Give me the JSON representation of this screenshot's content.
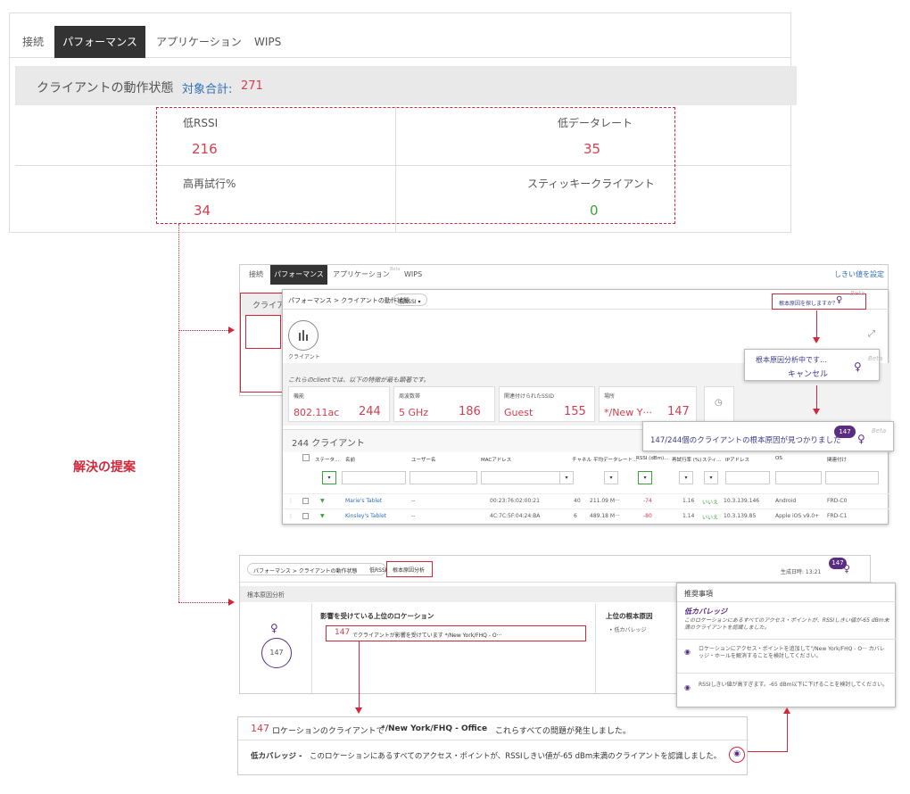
{
  "panel1": {
    "tabs": [
      "接続",
      "パフォーマンス",
      "アプリケーション",
      "WIPS"
    ],
    "title": "クライアントの動作状態",
    "count_label": "対象合計:",
    "count_value": "271",
    "metrics": [
      {
        "label": "低RSSI",
        "value": "216"
      },
      {
        "label": "低データレート",
        "value": "35"
      },
      {
        "label": "高再試行%",
        "value": "34"
      },
      {
        "label": "スティッキークライアント",
        "value": "0"
      }
    ]
  },
  "solution_label": "解決の提案",
  "panel2": {
    "tabs": [
      "接続",
      "パフォーマンス",
      "アプリケーション",
      "WIPS"
    ],
    "tab_beta": "Beta",
    "threshold_link": "しきい値を設定",
    "back_header": "クライア",
    "breadcrumb": "パフォーマンス > クライアントの動作状態",
    "breadcrumb_chip": "低RSSI ▾",
    "root_cause_question": "根本原因を探しますか？",
    "client_icon_label": "クライアント",
    "intro_text": "これらのclientでは、以下の特徴が最も顕著です。",
    "cards": [
      {
        "label": "機能",
        "a": "802.11ac",
        "b": "244"
      },
      {
        "label": "周波数帯",
        "a": "5 GHz",
        "b": "186"
      },
      {
        "label": "関連付けられたSSID",
        "a": "Guest",
        "b": "155"
      },
      {
        "label": "場所",
        "a": "*/New Y···",
        "b": "147"
      }
    ],
    "client_count_header": "244 クライアント",
    "columns": [
      "ステータ...",
      "名前",
      "ユーザー名",
      "MACアドレス",
      "チャネル",
      "平均データレート...",
      "RSSI (dBm)...",
      "再試行率 (%)",
      "スティ...",
      "IPアドレス",
      "OS",
      "関連付け"
    ],
    "rows": [
      {
        "name": "Marie's Tablet",
        "user": "--",
        "mac": "00:23:76:02:00:21",
        "ch": "40",
        "rate": "211.09 M···",
        "rssi": "-74",
        "retry": "1.16",
        "sticky": "いいえ",
        "ip": "10.3.139.146",
        "os": "Android",
        "assoc": "FRD-C0"
      },
      {
        "name": "Kinsley's Tablet",
        "user": "--",
        "mac": "4C:7C:5F:04:24:BA",
        "ch": "6",
        "rate": "489.18 M···",
        "rssi": "-80",
        "retry": "1.14",
        "sticky": "いいえ",
        "ip": "10.3.139.85",
        "os": "Apple iOS v9.0+",
        "assoc": "FRD-C1"
      }
    ],
    "analyzing_text": "根本原因分析中です…",
    "cancel_text": "キャンセル",
    "found_text": "147/244個のクライアントの根本原因が見つかりました",
    "found_badge": "147",
    "beta": "Beta"
  },
  "panel3": {
    "breadcrumb": "パフォーマンス > クライアントの動作状態",
    "chip1": "低RSSI",
    "chip2": "根本原因分析",
    "generated": "生成日時: 13:21",
    "badge": "147",
    "section_title": "根本原因分析",
    "circle_value": "147",
    "affected_title": "影響を受けている上位のロケーション",
    "affected_count": "147",
    "affected_text": "でクライアントが影響を受けています */New York/FHQ - O···",
    "root_cause_title": "上位の根本原因",
    "root_cause_item": "• 低カバレッジ",
    "rec": {
      "title": "推奨事項",
      "subtitle": "低カバレッジ",
      "desc": "このロケーションにあるすべてのアクセス・ポイントが、RSSIしきい値が-65 dBm未満のクライアントを認識しました。",
      "item1": "ロケーションにアクセス・ポイントを追加して\"/New York/FHQ - O···  カバレッジ・ホールを解消することを検討してください。",
      "item2": "RSSIしきい値が高すぎます。-65 dBm以下に下げることを検討してください。"
    }
  },
  "panel4": {
    "count": "147",
    "line1_pre": "ロケーションのクライアントで",
    "line1_loc": "*/New York/FHQ - Office",
    "line1_post": "これらすべての問題が発生しました。",
    "line2_bold": "低カバレッジ -",
    "line2_text": "このロケーションにあるすべてのアクセス・ポイントが、RSSIしきい値が-65 dBm未満のクライアントを認識しました。"
  }
}
